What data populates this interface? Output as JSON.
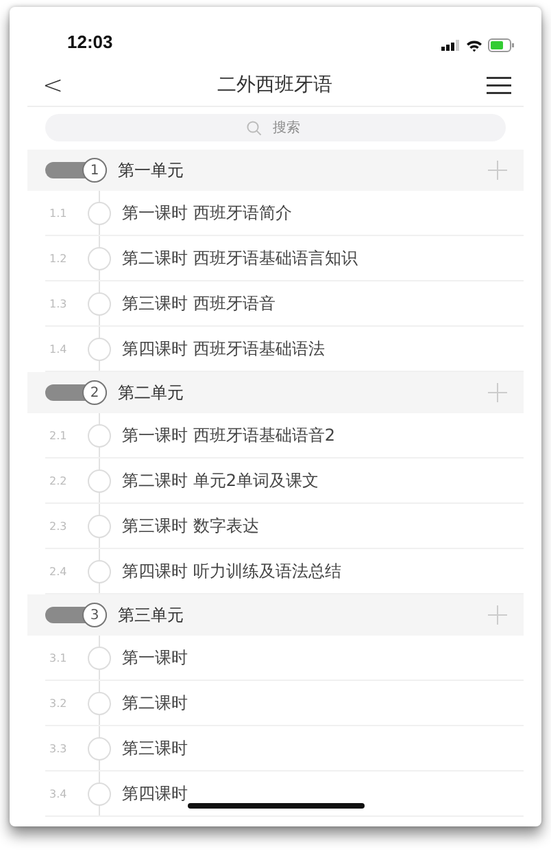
{
  "status_bar": {
    "time": "12:03"
  },
  "nav": {
    "back": "<",
    "title": "二外西班牙语"
  },
  "search": {
    "placeholder": "搜索"
  },
  "units": [
    {
      "number": "1",
      "title": "第一单元",
      "lessons": [
        {
          "number": "1.1",
          "title": "第一课时 西班牙语简介"
        },
        {
          "number": "1.2",
          "title": "第二课时 西班牙语基础语言知识"
        },
        {
          "number": "1.3",
          "title": "第三课时 西班牙语音"
        },
        {
          "number": "1.4",
          "title": "第四课时 西班牙语基础语法"
        }
      ]
    },
    {
      "number": "2",
      "title": "第二单元",
      "lessons": [
        {
          "number": "2.1",
          "title": "第一课时 西班牙语基础语音2"
        },
        {
          "number": "2.2",
          "title": "第二课时 单元2单词及课文"
        },
        {
          "number": "2.3",
          "title": "第三课时 数字表达"
        },
        {
          "number": "2.4",
          "title": "第四课时 听力训练及语法总结"
        }
      ]
    },
    {
      "number": "3",
      "title": "第三单元",
      "lessons": [
        {
          "number": "3.1",
          "title": "第一课时"
        },
        {
          "number": "3.2",
          "title": "第二课时"
        },
        {
          "number": "3.3",
          "title": "第三课时"
        },
        {
          "number": "3.4",
          "title": "第四课时"
        }
      ]
    }
  ]
}
